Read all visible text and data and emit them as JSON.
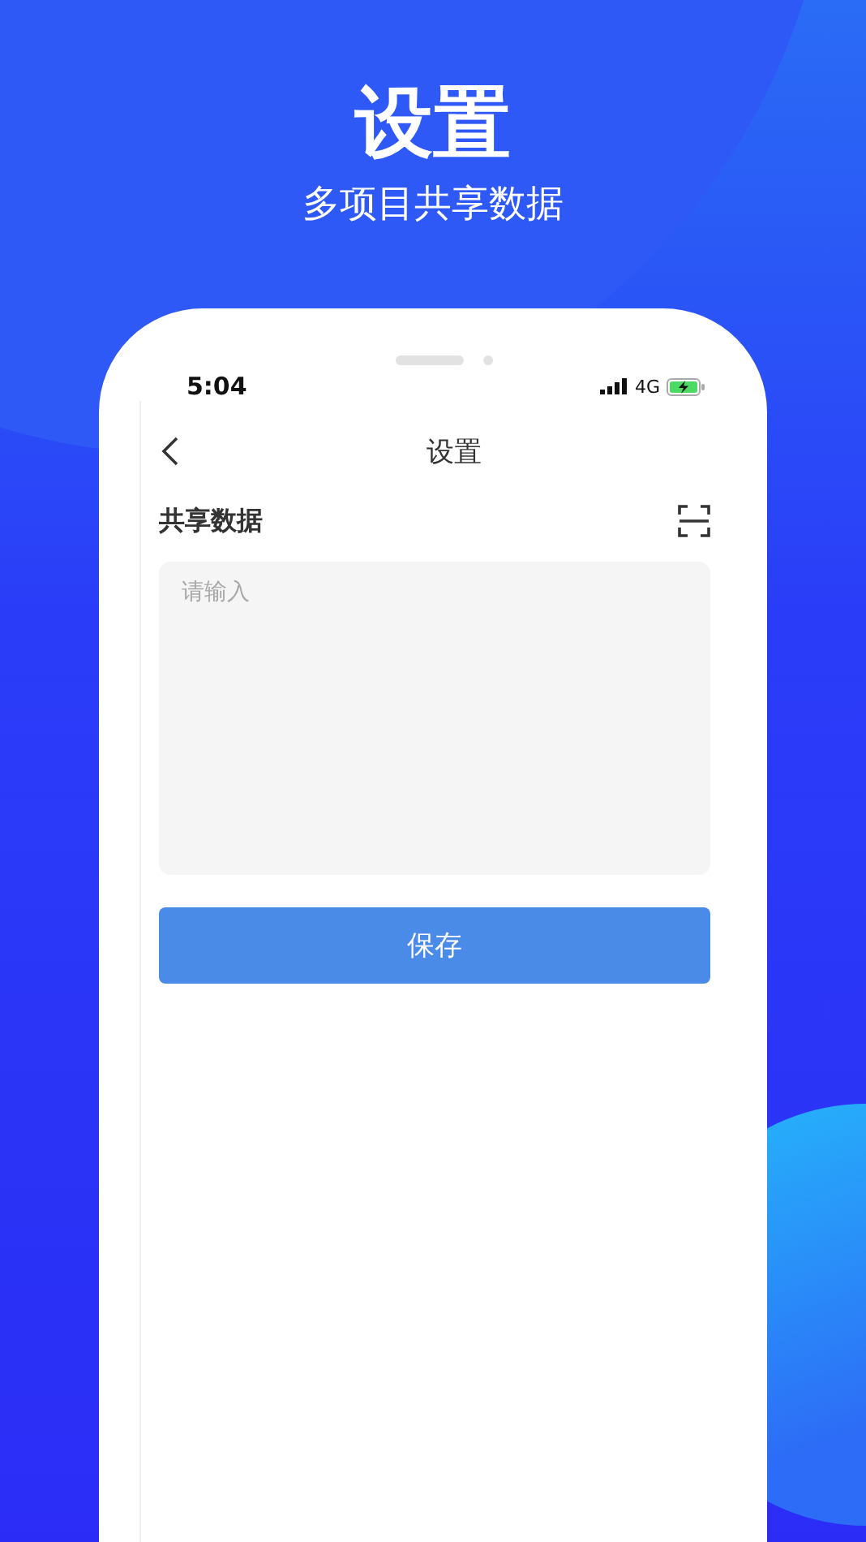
{
  "headline": {
    "title": "设置",
    "subtitle": "多项目共享数据"
  },
  "status_bar": {
    "time": "5:04",
    "network": "4G"
  },
  "nav_bar": {
    "title": "设置"
  },
  "form": {
    "label": "共享数据",
    "field": {
      "placeholder": "请输入"
    },
    "button": "保存"
  }
}
